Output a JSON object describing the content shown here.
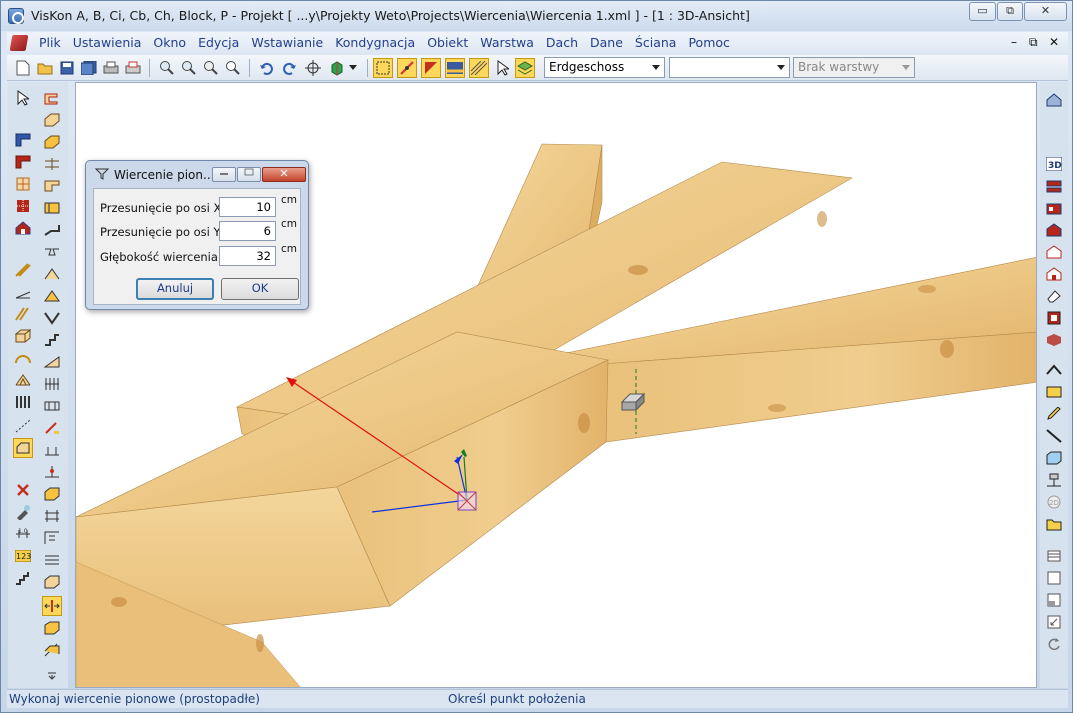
{
  "window": {
    "title": "VisKon A, B, Ci, Cb, Ch, Block, P - Projekt [ ...y\\Projekty Weto\\Projects\\Wiercenia\\Wiercenia 1.xml ]  - [1 : 3D-Ansicht]",
    "min_glyph": "▭",
    "max_glyph": "⧉",
    "close_glyph": "✕"
  },
  "menu": {
    "items": [
      "Plik",
      "Ustawienia",
      "Okno",
      "Edycja",
      "Wstawianie",
      "Kondygnacja",
      "Obiekt",
      "Warstwa",
      "Dach",
      "Dane",
      "Ściana",
      "Pomoc"
    ],
    "mdi_min": "–",
    "mdi_restore": "⧉",
    "mdi_close": "✕"
  },
  "toolbar": {
    "storey_value": "Erdgeschoss",
    "second_value": "",
    "layer_value": "Brak warstwy"
  },
  "dialog": {
    "title": "Wiercenie pion...",
    "close_glyph": "✕",
    "fields": [
      {
        "label": "Przesunięcie po osi X:",
        "value": "10",
        "unit": "cm"
      },
      {
        "label": "Przesunięcie po osi Y:",
        "value": "6",
        "unit": "cm"
      },
      {
        "label": "Głębokość wiercenia:",
        "value": "32",
        "unit": "cm"
      }
    ],
    "cancel_label": "Anuluj",
    "ok_label": "OK"
  },
  "status": {
    "left": "Wykonaj wiercenie pionowe (prostopadłe)",
    "center": "Określ punkt położenia"
  },
  "colors": {
    "wood_light": "#f3d49a",
    "wood_mid": "#e7b96f",
    "wood_dark": "#c98f45",
    "accent_active": "#ffd75a"
  }
}
